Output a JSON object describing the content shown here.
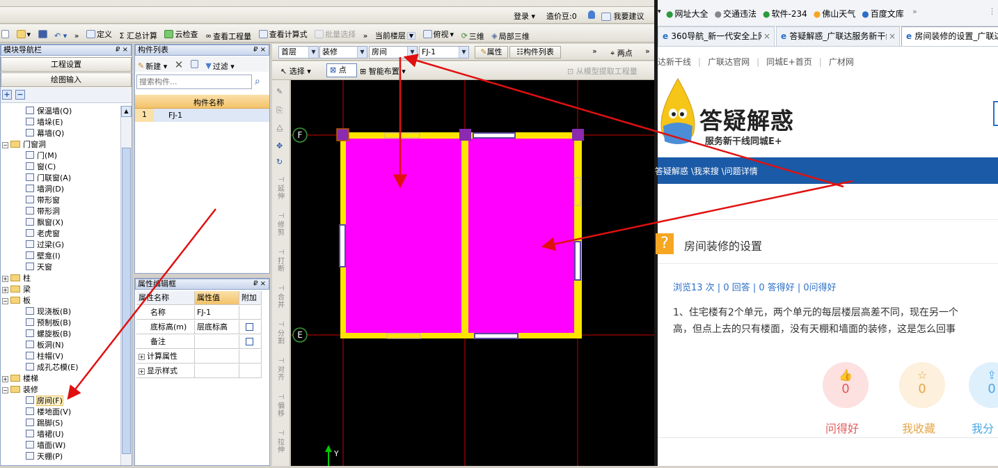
{
  "app": {
    "topbar": {
      "login": "登录 ▾",
      "price_beans": "造价豆:0",
      "suggest": "我要建议"
    },
    "toolbar1": {
      "define": "定义",
      "sum": "Σ 汇总计算",
      "cloud_check": "云检查",
      "view_qty": "查看工程量",
      "view_formula": "查看计算式",
      "batch_select": "批量选择",
      "current_floor": "当前楼层",
      "view_mode": "俯视",
      "three_d": "三维",
      "local_3d": "局部三维"
    },
    "nav_panel": {
      "title": "模块导航栏",
      "pin": "₽ ×",
      "project_settings": "工程设置",
      "drawing_input": "绘图输入",
      "tree": [
        {
          "label": "保温墙(Q)",
          "level": 2,
          "type": "item"
        },
        {
          "label": "墙垛(E)",
          "level": 2,
          "type": "item"
        },
        {
          "label": "幕墙(Q)",
          "level": 2,
          "type": "item"
        },
        {
          "label": "门窗洞",
          "level": 0,
          "type": "folder-open"
        },
        {
          "label": "门(M)",
          "level": 2,
          "type": "item"
        },
        {
          "label": "窗(C)",
          "level": 2,
          "type": "item"
        },
        {
          "label": "门联窗(A)",
          "level": 2,
          "type": "item"
        },
        {
          "label": "墙洞(D)",
          "level": 2,
          "type": "item"
        },
        {
          "label": "带形窗",
          "level": 2,
          "type": "item"
        },
        {
          "label": "带形洞",
          "level": 2,
          "type": "item"
        },
        {
          "label": "飘窗(X)",
          "level": 2,
          "type": "item"
        },
        {
          "label": "老虎窗",
          "level": 2,
          "type": "item"
        },
        {
          "label": "过梁(G)",
          "level": 2,
          "type": "item"
        },
        {
          "label": "壁龛(I)",
          "level": 2,
          "type": "item"
        },
        {
          "label": "天窗",
          "level": 2,
          "type": "item"
        },
        {
          "label": "柱",
          "level": 0,
          "type": "folder"
        },
        {
          "label": "梁",
          "level": 0,
          "type": "folder"
        },
        {
          "label": "板",
          "level": 0,
          "type": "folder-open"
        },
        {
          "label": "现浇板(B)",
          "level": 2,
          "type": "item"
        },
        {
          "label": "预制板(B)",
          "level": 2,
          "type": "item"
        },
        {
          "label": "螺旋板(B)",
          "level": 2,
          "type": "item"
        },
        {
          "label": "板洞(N)",
          "level": 2,
          "type": "item"
        },
        {
          "label": "柱帽(V)",
          "level": 2,
          "type": "item"
        },
        {
          "label": "成孔芯模(E)",
          "level": 2,
          "type": "item"
        },
        {
          "label": "楼梯",
          "level": 0,
          "type": "folder"
        },
        {
          "label": "装修",
          "level": 0,
          "type": "folder-open"
        },
        {
          "label": "房间(F)",
          "level": 2,
          "type": "item",
          "selected": true
        },
        {
          "label": "楼地面(V)",
          "level": 2,
          "type": "item"
        },
        {
          "label": "踢脚(S)",
          "level": 2,
          "type": "item"
        },
        {
          "label": "墙裙(U)",
          "level": 2,
          "type": "item"
        },
        {
          "label": "墙面(W)",
          "level": 2,
          "type": "item"
        },
        {
          "label": "天棚(P)",
          "level": 2,
          "type": "item"
        }
      ]
    },
    "component_list": {
      "title": "构件列表",
      "new": "新建 ▾",
      "filter": "过滤 ▾",
      "search_placeholder": "搜索构件...",
      "col_name": "构件名称",
      "rows": [
        {
          "no": "1",
          "name": "FJ-1"
        }
      ]
    },
    "property_panel": {
      "title": "属性编辑框",
      "headers": [
        "属性名称",
        "属性值",
        "附加"
      ],
      "rows": [
        {
          "name": "名称",
          "value": "FJ-1",
          "check": false
        },
        {
          "name": "底标高(m)",
          "value": "层底标高",
          "check": true
        },
        {
          "name": "备注",
          "value": "",
          "check": true
        },
        {
          "name": "计算属性",
          "value": "",
          "check": false,
          "expand": "+"
        },
        {
          "name": "显示样式",
          "value": "",
          "check": false,
          "expand": "+"
        }
      ]
    },
    "drawing_toolbar": {
      "floor": "首层",
      "category": "装修",
      "type": "房间",
      "component": "FJ-1",
      "property_btn": "属性",
      "list_btn": "构件列表",
      "two_points": "两点",
      "select": "选择 ▾",
      "point": "点",
      "smart_place": "智能布置 ▾",
      "extract": "从模型提取工程量"
    },
    "side_tools": [
      "延伸",
      "修剪",
      "打断",
      "合并",
      "分割",
      "对齐",
      "偏移",
      "拉伸"
    ],
    "canvas": {
      "axis_f": "F",
      "axis_e": "E",
      "y_label": "Y"
    }
  },
  "browser": {
    "bookmarks": [
      "网址大全",
      "交通违法",
      "软件-234",
      "佛山天气",
      "百度文库"
    ],
    "tabs": [
      "360导航_新一代安全上网",
      "答疑解惑_广联达服务新干线",
      "房间装修的设置_广联达"
    ],
    "subnav": [
      "达新干线",
      "广联达官网",
      "同城E+首页",
      "广材网"
    ],
    "logo_title": "答疑解惑",
    "logo_sub": "服务新干线同城E+",
    "breadcrumb": "答疑解惑 \\我来搜 \\问题详情",
    "question_title": "房间装修的设置",
    "stats": "浏览13 次 | 0 回答 | 0 答得好 | 0问得好",
    "body_line1": "1、住宅楼有2个单元，两个单元的每层楼层高差不同，现在另一个",
    "body_line2": "高，但点上去的只有楼面，没有天棚和墙面的装修，这是怎么回事",
    "actions": [
      {
        "label": "问得好",
        "count": "0",
        "color": "#e05a5a"
      },
      {
        "label": "我收藏",
        "count": "0",
        "color": "#e5a64a"
      },
      {
        "label": "我分",
        "count": "0",
        "color": "#4aa6e5"
      }
    ]
  },
  "colors": {
    "room_fill": "#ff00ff",
    "wall": "#ffe400",
    "arrow": "#e01010",
    "blue_band": "#1b5aa6"
  }
}
